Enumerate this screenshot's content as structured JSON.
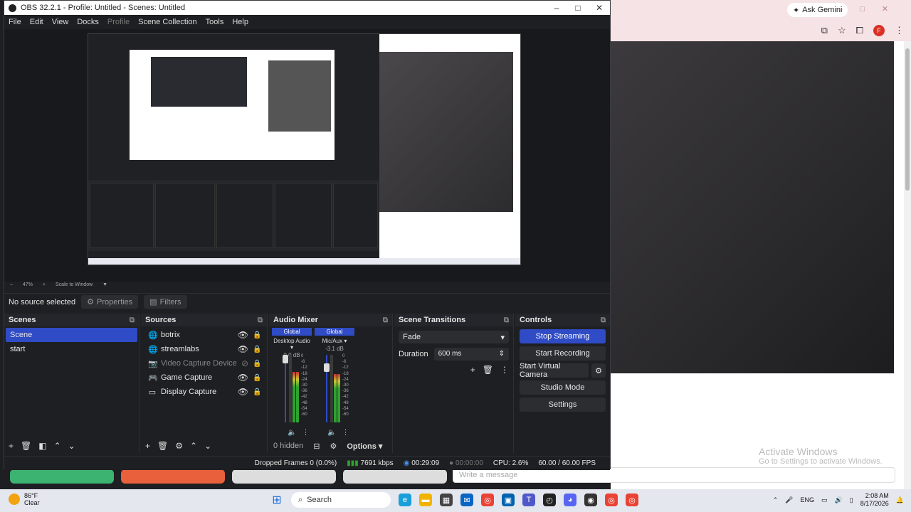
{
  "browser": {
    "ask_label": "Ask Gemini",
    "avatar_letter": "F",
    "activate_title": "Activate Windows",
    "activate_sub": "Go to Settings to activate Windows.",
    "message_placeholder": "Write a message"
  },
  "obs": {
    "title": "OBS 32.2.1 - Profile: Untitled - Scenes: Untitled",
    "menu": [
      "File",
      "Edit",
      "View",
      "Docks",
      "Profile",
      "Scene Collection",
      "Tools",
      "Help"
    ],
    "preview_bar": {
      "zoom": "47%",
      "scale": "Scale to Window"
    },
    "no_source": "No source selected",
    "properties_label": "Properties",
    "filters_label": "Filters",
    "scenes": {
      "title": "Scenes",
      "items": [
        "Scene",
        "start"
      ],
      "selected": "Scene"
    },
    "sources": {
      "title": "Sources",
      "items": [
        {
          "name": "botrix",
          "icon": "globe-icon",
          "visible": true
        },
        {
          "name": "streamlabs",
          "icon": "globe-icon",
          "visible": true
        },
        {
          "name": "Video Capture Device",
          "icon": "camera-icon",
          "visible": false
        },
        {
          "name": "Game Capture",
          "icon": "gamepad-icon",
          "visible": true
        },
        {
          "name": "Display Capture",
          "icon": "monitor-icon",
          "visible": true
        }
      ]
    },
    "mixer": {
      "title": "Audio Mixer",
      "channels": [
        {
          "global": "Global",
          "name": "Desktop Audio",
          "db": "0.0 dB",
          "level": 0.75
        },
        {
          "global": "Global",
          "name": "Mic/Aux",
          "db": "-3.1 dB",
          "level": 0.72
        }
      ],
      "scale": [
        "0",
        "-6",
        "-12",
        "-18",
        "-24",
        "-30",
        "-36",
        "-42",
        "-48",
        "-54",
        "-60"
      ],
      "hidden": "0 hidden",
      "options": "Options"
    },
    "transitions": {
      "title": "Scene Transitions",
      "selected": "Fade",
      "duration_label": "Duration",
      "duration": "600 ms"
    },
    "controls": {
      "title": "Controls",
      "stop_streaming": "Stop Streaming",
      "start_recording": "Start Recording",
      "start_virtual_camera": "Start Virtual Camera",
      "studio_mode": "Studio Mode",
      "settings": "Settings"
    },
    "status": {
      "dropped": "Dropped Frames 0 (0.0%)",
      "bitrate": "7691 kbps",
      "stream_time": "00:29:09",
      "rec_time": "00:00:00",
      "cpu": "CPU: 2.6%",
      "fps": "60.00 / 60.00 FPS"
    }
  },
  "taskbar": {
    "temp": "86°F",
    "weather": "Clear",
    "search": "Search",
    "lang": "ENG",
    "time": "2:08 AM",
    "date": "8/17/2026"
  },
  "colors": {
    "accent": "#2f4bc5",
    "meter_green": "#2fa22f",
    "bg": "#1e1f22"
  }
}
